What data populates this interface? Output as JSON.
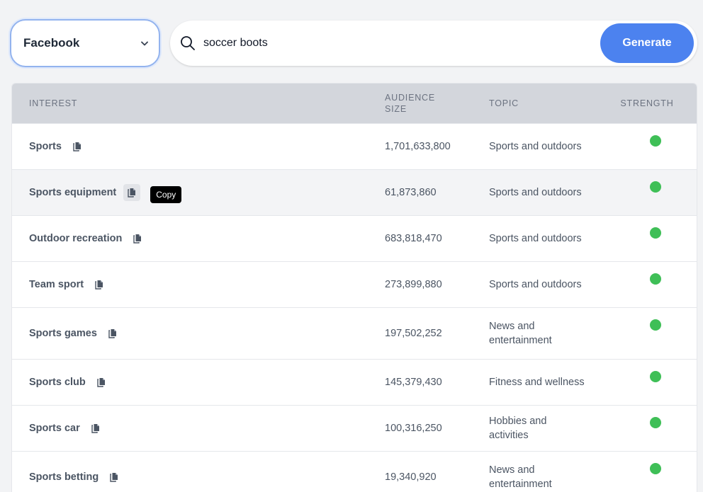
{
  "platform_select": {
    "value": "Facebook",
    "icon": "chevron-down-icon"
  },
  "search": {
    "value": "soccer boots",
    "icon": "search-icon"
  },
  "generate_button": {
    "label": "Generate",
    "color": "#4c82ef"
  },
  "table": {
    "headers": {
      "interest": "INTEREST",
      "audience_size": "AUDIENCE SIZE",
      "topic": "TOPIC",
      "strength": "STRENGTH"
    },
    "copy_tooltip": "Copy",
    "strength_color": "#3fbf57",
    "rows": [
      {
        "interest": "Sports",
        "audience_size": "1,701,633,800",
        "topic": "Sports and outdoors",
        "strength": "high"
      },
      {
        "interest": "Sports equipment",
        "audience_size": "61,873,860",
        "topic": "Sports and outdoors",
        "strength": "high"
      },
      {
        "interest": "Outdoor recreation",
        "audience_size": "683,818,470",
        "topic": "Sports and outdoors",
        "strength": "high"
      },
      {
        "interest": "Team sport",
        "audience_size": "273,899,880",
        "topic": "Sports and outdoors",
        "strength": "high"
      },
      {
        "interest": "Sports games",
        "audience_size": "197,502,252",
        "topic": "News and entertainment",
        "strength": "high"
      },
      {
        "interest": "Sports club",
        "audience_size": "145,379,430",
        "topic": "Fitness and wellness",
        "strength": "high"
      },
      {
        "interest": "Sports car",
        "audience_size": "100,316,250",
        "topic": "Hobbies and activities",
        "strength": "high"
      },
      {
        "interest": "Sports betting",
        "audience_size": "19,340,920",
        "topic": "News and entertainment",
        "strength": "high"
      }
    ]
  }
}
